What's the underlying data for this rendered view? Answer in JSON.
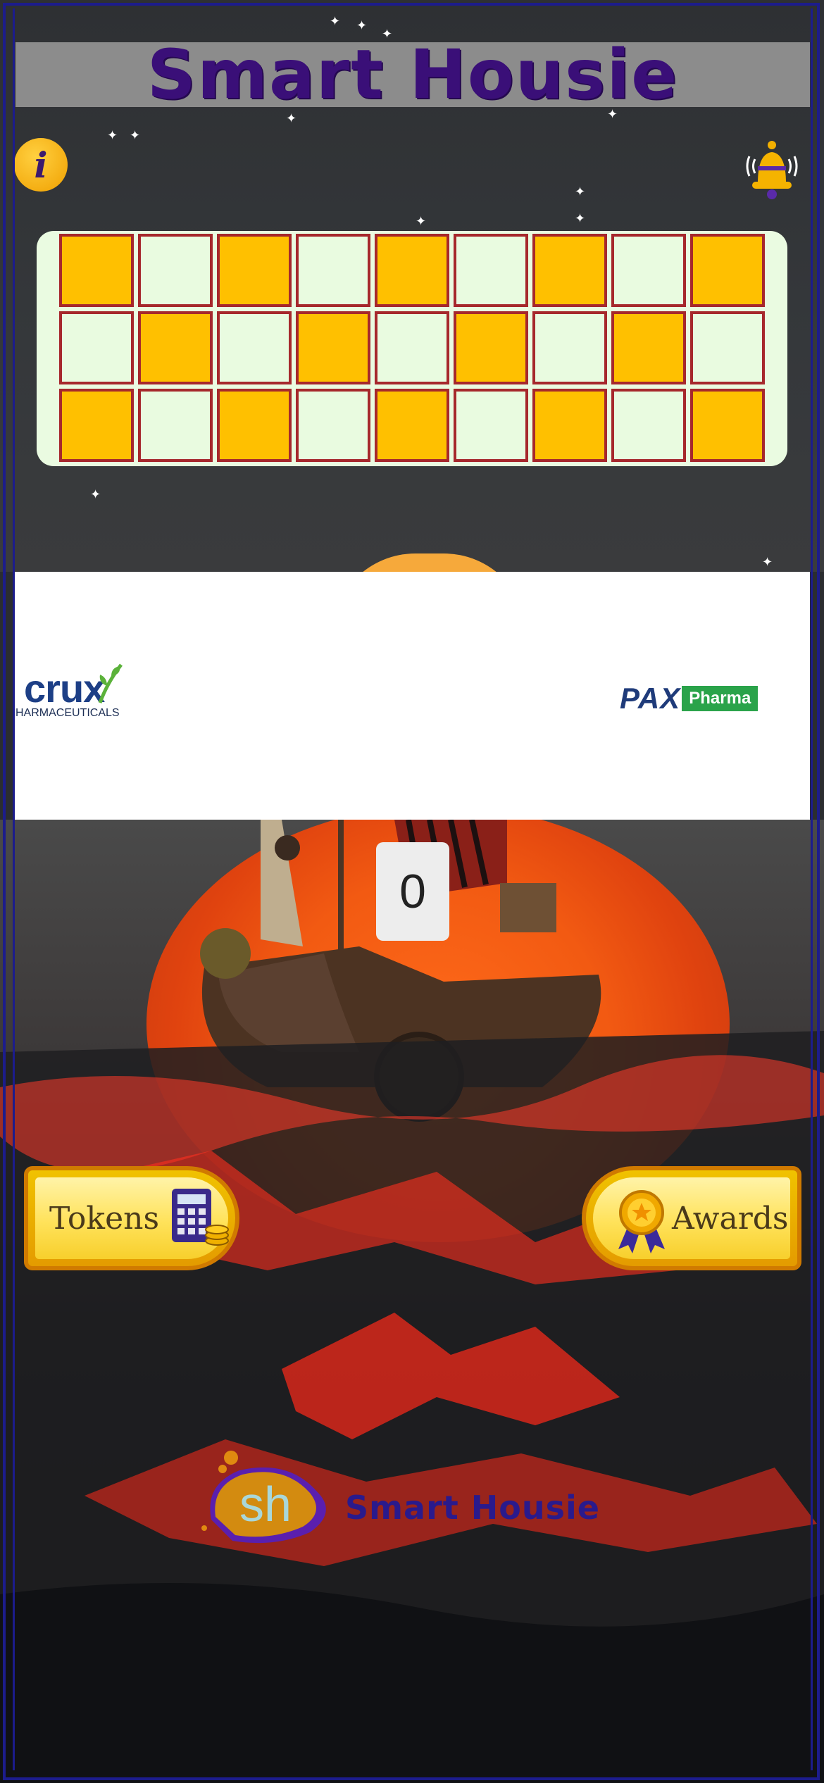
{
  "header": {
    "title": "Smart Housie"
  },
  "icons": {
    "info": "info-icon",
    "notifications": "bell-icon"
  },
  "info_glyph": "i",
  "ticket": {
    "rows": [
      [
        "on",
        "off",
        "on",
        "off",
        "on",
        "off",
        "on",
        "off",
        "on"
      ],
      [
        "off",
        "on",
        "off",
        "on",
        "off",
        "on",
        "off",
        "on",
        "off"
      ],
      [
        "on",
        "off",
        "on",
        "off",
        "on",
        "off",
        "on",
        "off",
        "on"
      ]
    ]
  },
  "sponsors": {
    "left": {
      "name": "crux",
      "subtitle": "HARMACEUTICALS"
    },
    "right": {
      "name": "PAX",
      "tag": "Pharma"
    }
  },
  "counter": {
    "value": "0"
  },
  "buttons": {
    "tokens": "Tokens",
    "awards": "Awards"
  },
  "brand": {
    "mark": "sh",
    "name": "Smart Housie"
  },
  "colors": {
    "title": "#3a0f78",
    "ticket_on": "#ffc000",
    "ticket_off": "#e9fbe0",
    "ticket_border": "#a6282c",
    "frame": "#1c1c8c",
    "button_gold": "#f0c200"
  }
}
